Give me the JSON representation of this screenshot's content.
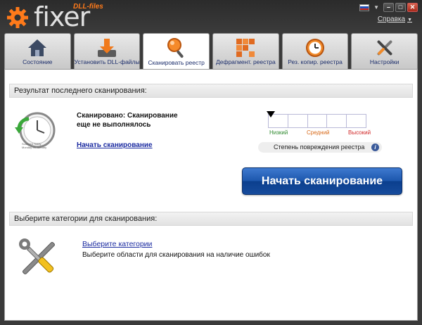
{
  "app": {
    "logo_brand": "DLL-files",
    "logo_name": "fixer",
    "help_label": "Справка"
  },
  "window_controls": {
    "minimize": "–",
    "maximize": "□",
    "close": "✕"
  },
  "tabs": [
    {
      "label": "Состояние",
      "icon": "home-icon"
    },
    {
      "label": "Установить DLL-файлы",
      "icon": "download-icon"
    },
    {
      "label": "Сканировать реестр",
      "icon": "magnifier-icon",
      "active": true
    },
    {
      "label": "Дефрагмент. реестра",
      "icon": "defrag-blocks-icon"
    },
    {
      "label": "Рез. копир. реестра",
      "icon": "backup-clock-icon"
    },
    {
      "label": "Настройки",
      "icon": "tools-icon"
    }
  ],
  "last_scan": {
    "header": "Результат последнего сканирования:",
    "status_line1": "Сканировано: Сканирование",
    "status_line2": "еще не выполнялось",
    "start_link": "Начать сканирование",
    "clock_caption1": "Scanned Today",
    "clock_caption2": "Monday 26 January"
  },
  "damage_meter": {
    "levels": [
      "Низкий",
      "Средний",
      "Высокий"
    ],
    "label": "Степень повреждения реестра",
    "info": "i",
    "level_value": 0
  },
  "start_button": {
    "label": "Начать сканирование"
  },
  "categories": {
    "header": "Выберите категории для сканирования:",
    "link": "Выберите категории",
    "description": "Выберите области для сканирования на наличие ошибок"
  },
  "colors": {
    "accent_orange": "#ff7a1a",
    "button_blue": "#1d57ad",
    "link_blue": "#1a2aa0",
    "low": "#2f8a2f",
    "mid": "#d86a1a",
    "high": "#d12a2a"
  }
}
